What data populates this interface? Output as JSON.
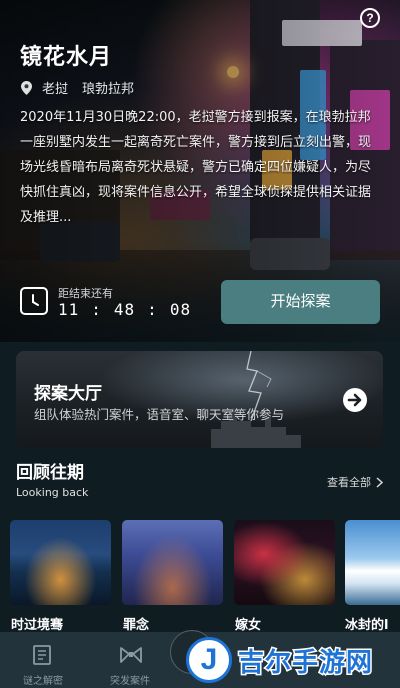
{
  "hero": {
    "help_label": "?",
    "title": "镜花水月",
    "location_1": "老挝",
    "location_2": "琅勃拉邦",
    "description": "2020年11月30日晚22:00，老挝警方接到报案，在琅勃拉邦一座别墅内发生一起离奇死亡案件，警方接到后立刻出警，现场光线昏暗布局离奇死状悬疑，警方已确定四位嫌疑人，为尽快抓住真凶，现将案件信息公开，希望全球侦探提供相关证据及推理...",
    "countdown_label": "距结束还有",
    "countdown": {
      "hours": "11",
      "minutes": "48",
      "seconds": "08"
    },
    "start_button": "开始探案",
    "accent_color": "#4a7e80"
  },
  "hall": {
    "title": "探案大厅",
    "subtitle": "组队体验热门案件，语音室、聊天室等你参与"
  },
  "review": {
    "title": "回顾往期",
    "subtitle": "Looking back",
    "see_all": "查看全部",
    "items": [
      {
        "label": "时过境骞"
      },
      {
        "label": "罪念"
      },
      {
        "label": "嫁女"
      },
      {
        "label": "冰封的l"
      }
    ]
  },
  "nav": {
    "items": [
      {
        "label": "谜之解密",
        "icon": "book-icon"
      },
      {
        "label": "突发案件",
        "icon": "bowtie-icon"
      }
    ]
  },
  "watermark": {
    "logo_letter": "J",
    "text": "吉尔手游网",
    "color": "#1e73d6"
  }
}
